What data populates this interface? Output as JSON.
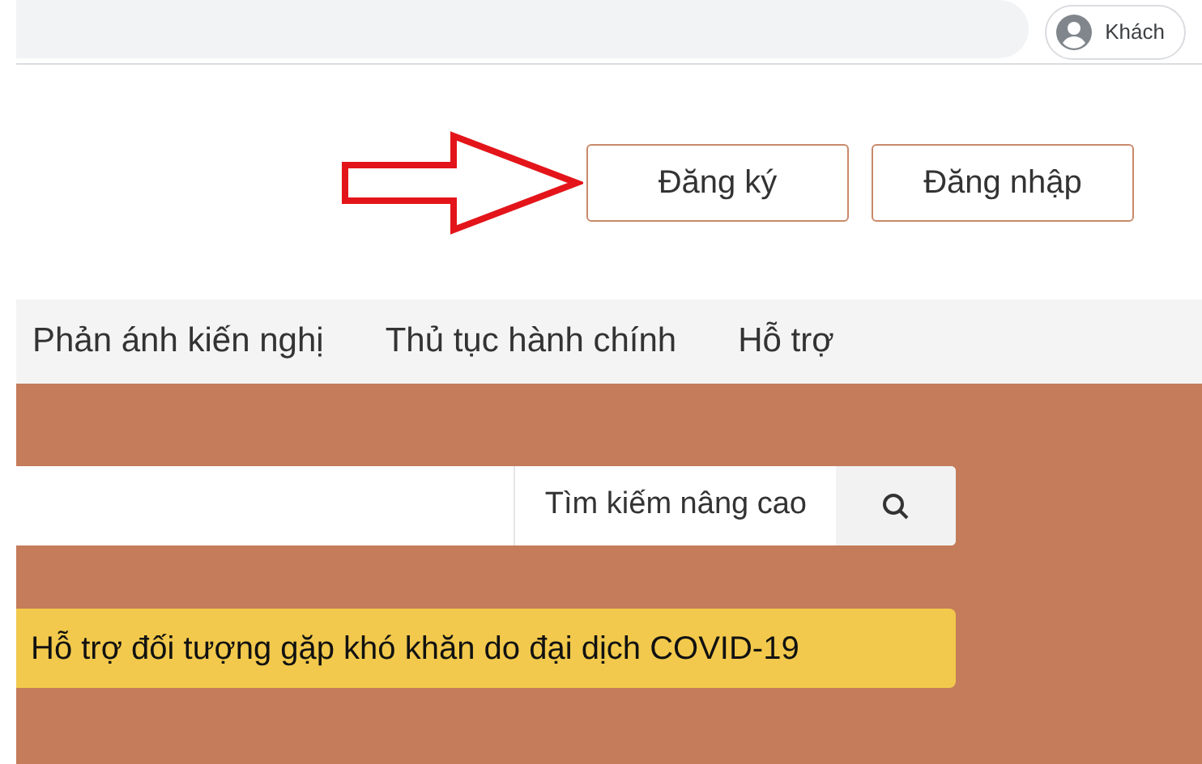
{
  "browser_bar": {
    "profile_label": "Khách"
  },
  "header": {
    "buttons": [
      "Đăng ký",
      "Đăng nhập"
    ]
  },
  "nav": {
    "items": [
      "Phản ánh kiến nghị",
      "Thủ tục hành chính",
      "Hỗ trợ"
    ]
  },
  "search": {
    "advanced_label": "Tìm kiếm nâng cao"
  },
  "notice": "Hỗ trợ đối tượng gặp khó khăn do đại dịch COVID-19"
}
